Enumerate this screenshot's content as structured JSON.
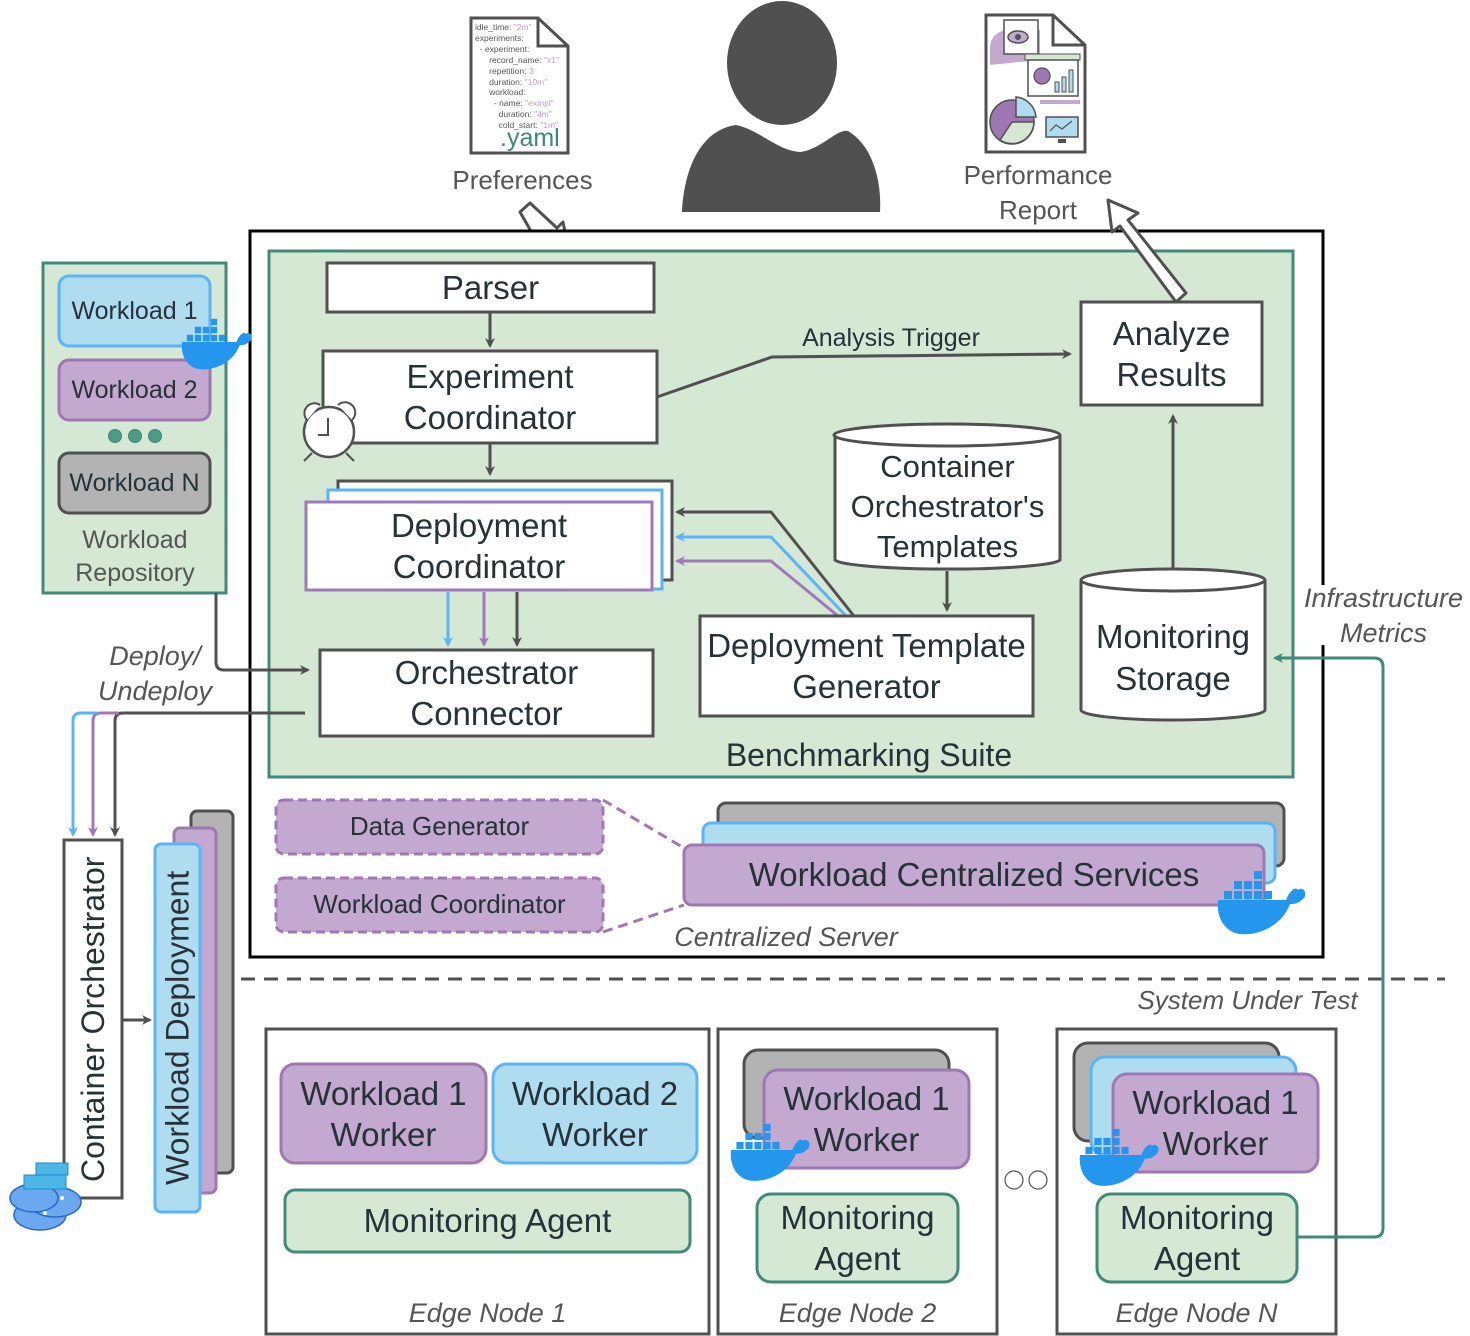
{
  "diagram": {
    "top": {
      "preferences_label": "Preferences",
      "report_label": "Performance Report",
      "yaml_file": {
        "extension": ".yaml",
        "lines": [
          {
            "key": "idle_time: ",
            "value": "\"2m\""
          },
          {
            "key": "experiments:",
            "value": ""
          },
          {
            "key": "  - experiment:",
            "value": ""
          },
          {
            "key": "      record_name: ",
            "value": "\"x1\""
          },
          {
            "key": "      repetition: ",
            "value": "3"
          },
          {
            "key": "      duration: ",
            "value": "\"10m\""
          },
          {
            "key": "      workload:",
            "value": ""
          },
          {
            "key": "        - name: ",
            "value": "\"exmpl\""
          },
          {
            "key": "          duration: ",
            "value": "\"4m\""
          },
          {
            "key": "          cold_start: ",
            "value": "\"1m\""
          }
        ]
      }
    },
    "repository": {
      "items": [
        "Workload 1",
        "Workload 2",
        "Workload N"
      ],
      "label": "Workload Repository"
    },
    "benchmarking_suite": {
      "label": "Benchmarking Suite",
      "parser": "Parser",
      "experiment_coordinator": "Experiment Coordinator",
      "deployment_coordinator": "Deployment Coordinator",
      "orchestrator_connector": "Orchestrator Connector",
      "templates_db": "Container Orchestrator's Templates",
      "template_generator": "Deployment Template Generator",
      "analyze_results": "Analyze Results",
      "monitoring_storage": "Monitoring Storage",
      "analysis_trigger": "Analysis Trigger"
    },
    "centralized_server": {
      "label": "Centralized Server",
      "data_generator": "Data Generator",
      "workload_coordinator": "Workload Coordinator",
      "centralized_services": "Workload Centralized Services"
    },
    "deploy_label": "Deploy/ Undeploy",
    "container_orchestrator": "Container Orchestrator",
    "workload_deployment": "Workload Deployment",
    "infra_metrics_label": "Infrastructure Metrics",
    "system_under_test": "System Under Test",
    "edge_nodes": [
      {
        "label": "Edge Node 1",
        "workers": [
          "Workload 1 Worker",
          "Workload 2 Worker"
        ],
        "agent": "Monitoring Agent"
      },
      {
        "label": "Edge Node 2",
        "workers": [
          "Workload 1 Worker"
        ],
        "agent": "Monitoring Agent"
      },
      {
        "label": "Edge Node N",
        "workers": [
          "Workload 1 Worker"
        ],
        "agent": "Monitoring Agent"
      }
    ],
    "colors": {
      "green_fill": "#d5e8d4",
      "green_stroke": "#3f8a78",
      "purple_fill": "#c3a9cf",
      "purple_stroke": "#9f78b3",
      "blue_fill": "#b0dcf0",
      "blue_stroke": "#5ab4f7",
      "gray_fill": "#b3b3b3",
      "dark_stroke": "#505050",
      "docker_blue": "#2496ed"
    }
  }
}
